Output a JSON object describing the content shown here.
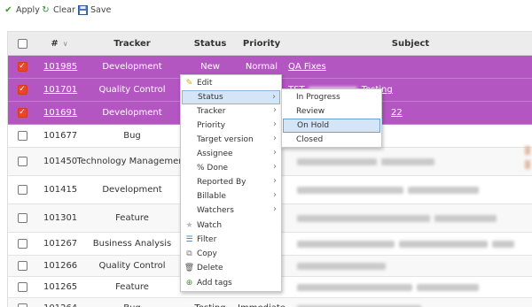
{
  "toolbar": {
    "apply": "Apply",
    "clear": "Clear",
    "save": "Save"
  },
  "table": {
    "headers": {
      "id": "#",
      "tracker": "Tracker",
      "status": "Status",
      "priority": "Priority",
      "subject": "Subject"
    },
    "rows": [
      {
        "id": "101985",
        "tracker": "Development",
        "status": "New",
        "priority": "Normal",
        "subject": "QA Fixes",
        "selected": true
      },
      {
        "id": "101701",
        "tracker": "Quality Control",
        "status": "",
        "priority": "",
        "subject": "TST",
        "subject_tail": "Testing",
        "selected": true
      },
      {
        "id": "101691",
        "tracker": "Development",
        "status": "",
        "priority": "",
        "subject": "",
        "subject_tail": "22",
        "selected": true
      },
      {
        "id": "101677",
        "tracker": "Bug",
        "status": "",
        "priority": "",
        "subject": "",
        "selected": false
      },
      {
        "id": "101450",
        "tracker": "Technology Management",
        "status": "",
        "priority": "",
        "subject": "",
        "selected": false
      },
      {
        "id": "101415",
        "tracker": "Development",
        "status": "",
        "priority": "",
        "subject": "",
        "selected": false
      },
      {
        "id": "101301",
        "tracker": "Feature",
        "status": "",
        "priority": "",
        "subject": "",
        "selected": false
      },
      {
        "id": "101267",
        "tracker": "Business Analysis",
        "status": "",
        "priority": "",
        "subject": "",
        "selected": false
      },
      {
        "id": "101266",
        "tracker": "Quality Control",
        "status": "",
        "priority": "",
        "subject": "",
        "selected": false
      },
      {
        "id": "101265",
        "tracker": "Feature",
        "status": "",
        "priority": "",
        "subject": "",
        "selected": false
      },
      {
        "id": "101264",
        "tracker": "Bug",
        "status": "Testing",
        "priority": "Immediate",
        "subject": "",
        "selected": false
      }
    ]
  },
  "context_menu": {
    "items": [
      "Edit",
      "Status",
      "Tracker",
      "Priority",
      "Target version",
      "Assignee",
      "% Done",
      "Reported By",
      "Billable",
      "Watchers",
      "Watch",
      "Filter",
      "Copy",
      "Delete",
      "Add tags"
    ],
    "highlighted": "Status"
  },
  "status_submenu": {
    "items": [
      "In Progress",
      "Review",
      "On Hold",
      "Closed"
    ],
    "highlighted": "On Hold"
  },
  "colors": {
    "selected_row": "#b456c2",
    "checkbox_on": "#e8452b",
    "menu_highlight": "#d4e5f7"
  }
}
